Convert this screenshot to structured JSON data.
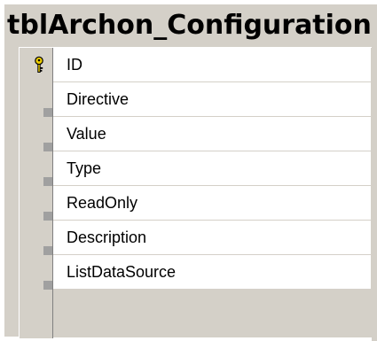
{
  "table": {
    "title": "tblArchon_Configuration",
    "fields": [
      {
        "name": "ID",
        "primary_key": true,
        "icon": "key-icon"
      },
      {
        "name": "Directive",
        "primary_key": false
      },
      {
        "name": "Value",
        "primary_key": false
      },
      {
        "name": "Type",
        "primary_key": false
      },
      {
        "name": "ReadOnly",
        "primary_key": false
      },
      {
        "name": "Description",
        "primary_key": false
      },
      {
        "name": "ListDataSource",
        "primary_key": false
      }
    ]
  },
  "colors": {
    "window": "#d4d0c8",
    "cell": "#ffffff",
    "key": "#f0d000"
  }
}
